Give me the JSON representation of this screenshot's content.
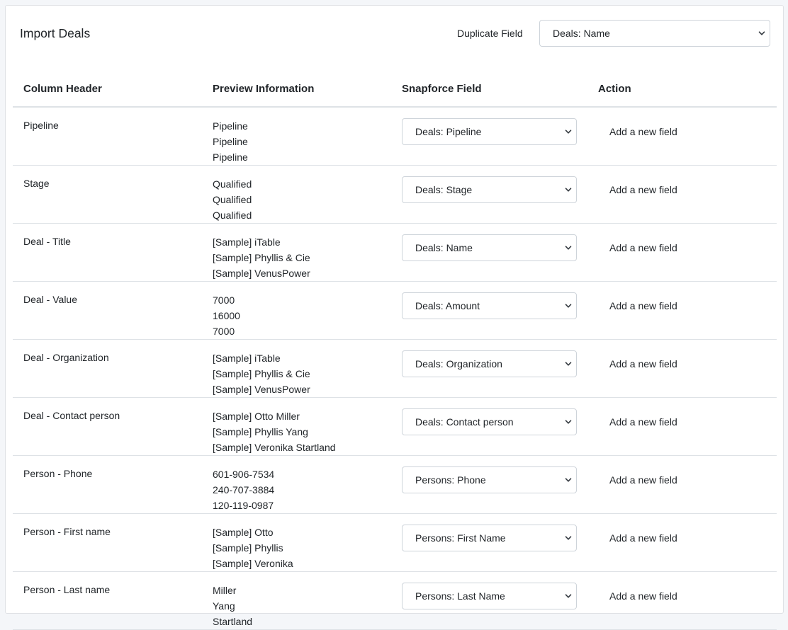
{
  "header": {
    "title": "Import Deals",
    "duplicate_label": "Duplicate Field",
    "duplicate_value": "Deals: Name"
  },
  "table": {
    "columns": [
      "Column Header",
      "Preview Information",
      "Snapforce Field",
      "Action"
    ],
    "rows": [
      {
        "header": "Pipeline",
        "preview": [
          "Pipeline",
          "Pipeline",
          "Pipeline"
        ],
        "field": "Deals: Pipeline",
        "action": "Add a new field"
      },
      {
        "header": "Stage",
        "preview": [
          "Qualified",
          "Qualified",
          "Qualified"
        ],
        "field": "Deals: Stage",
        "action": "Add a new field"
      },
      {
        "header": "Deal - Title",
        "preview": [
          "[Sample] iTable",
          "[Sample] Phyllis & Cie",
          "[Sample] VenusPower"
        ],
        "field": "Deals: Name",
        "action": "Add a new field"
      },
      {
        "header": "Deal - Value",
        "preview": [
          "7000",
          "16000",
          "7000"
        ],
        "field": "Deals: Amount",
        "action": "Add a new field"
      },
      {
        "header": "Deal - Organization",
        "preview": [
          "[Sample] iTable",
          "[Sample] Phyllis & Cie",
          "[Sample] VenusPower"
        ],
        "field": "Deals: Organization",
        "action": "Add a new field"
      },
      {
        "header": "Deal - Contact person",
        "preview": [
          "[Sample] Otto Miller",
          "[Sample] Phyllis Yang",
          "[Sample] Veronika Startland"
        ],
        "field": "Deals: Contact person",
        "action": "Add a new field"
      },
      {
        "header": "Person - Phone",
        "preview": [
          "601-906-7534",
          "240-707-3884",
          "120-119-0987"
        ],
        "field": "Persons: Phone",
        "action": "Add a new field"
      },
      {
        "header": "Person - First name",
        "preview": [
          "[Sample] Otto",
          "[Sample] Phyllis",
          "[Sample] Veronika"
        ],
        "field": "Persons: First Name",
        "action": "Add a new field"
      },
      {
        "header": "Person - Last name",
        "preview": [
          "Miller",
          "Yang",
          "Startland"
        ],
        "field": "Persons: Last Name",
        "action": "Add a new field"
      }
    ]
  },
  "icons": {
    "dropdown": "chevron-down-icon"
  }
}
